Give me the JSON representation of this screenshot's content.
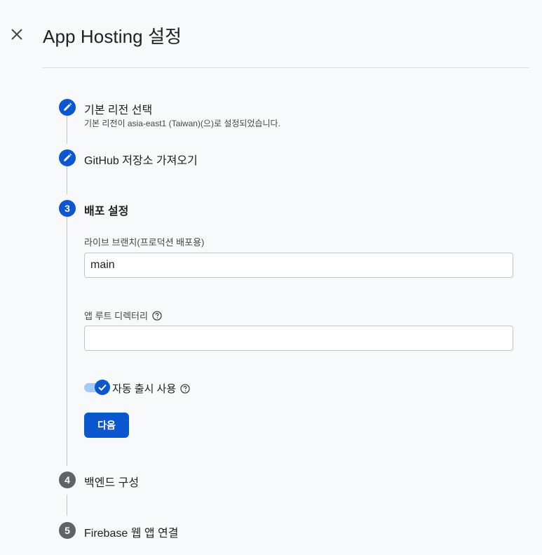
{
  "header": {
    "title": "App Hosting 설정",
    "close_icon": "close-icon"
  },
  "steps": [
    {
      "number": "1",
      "status": "done",
      "icon": "pencil-icon",
      "title": "기본 리전 선택",
      "subtitle": "기본 리전이 asia-east1 (Taiwan)(으)로 설정되었습니다."
    },
    {
      "number": "2",
      "status": "done",
      "icon": "pencil-icon",
      "title": "GitHub 저장소 가져오기"
    },
    {
      "number": "3",
      "status": "active",
      "title": "배포 설정"
    },
    {
      "number": "4",
      "status": "pending",
      "title": "백엔드 구성"
    },
    {
      "number": "5",
      "status": "pending",
      "title": "Firebase 웹 앱 연결"
    }
  ],
  "deploy_settings": {
    "live_branch_label": "라이브 브랜치(프로덕션 배포용)",
    "live_branch_value": "main",
    "root_dir_label": "앱 루트 디렉터리",
    "root_dir_value": "",
    "auto_rollout_label": "자동 출시 사용",
    "auto_rollout_enabled": true,
    "next_button_label": "다음"
  },
  "colors": {
    "accent": "#0b57d0",
    "pending_step": "#5f6368",
    "toggle_track": "#a8c7fa",
    "background": "#f8f9fa"
  }
}
